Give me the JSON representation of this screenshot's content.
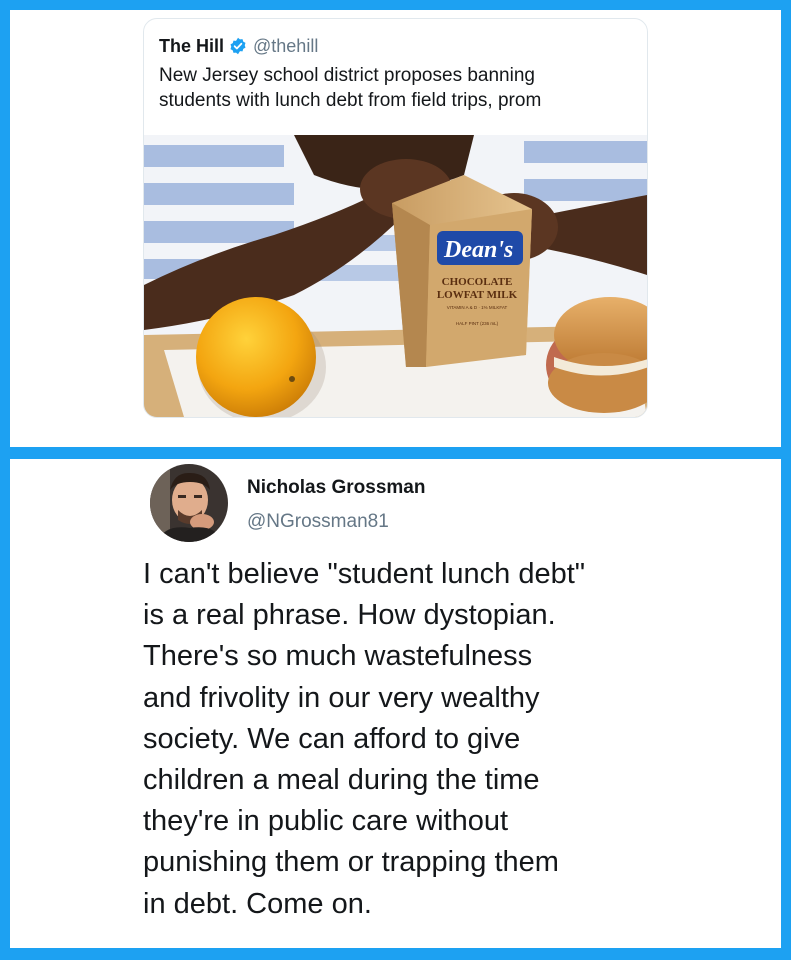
{
  "top_tweet": {
    "source_name": "The Hill",
    "source_handle": "@thehill",
    "headline_lines": [
      "New Jersey school district proposes banning",
      "students with lunch debt from field trips, prom"
    ],
    "photo": {
      "carton_brand": "Dean's",
      "carton_line1": "CHOCOLATE",
      "carton_line2": "LOWFAT MILK",
      "carton_small1": "VITAMIN A & D · 1% MILKFAT",
      "carton_small2": "HALF PINT (236 mL)"
    }
  },
  "bottom_tweet": {
    "author_name": "Nicholas Grossman",
    "author_handle": "@NGrossman81",
    "text_lines": [
      "I can't believe \"student lunch debt\"",
      "is a real phrase. How dystopian.",
      "There's so much wastefulness",
      "and frivolity in our very wealthy",
      "society. We can afford to give",
      "children a meal during the time",
      "they're in public care without",
      "punishing them or trapping them",
      "in debt. Come on."
    ]
  },
  "colors": {
    "frame": "#1da1f2",
    "verified": "#1da1f2",
    "text": "#14171a",
    "secondary_text": "#657786"
  }
}
